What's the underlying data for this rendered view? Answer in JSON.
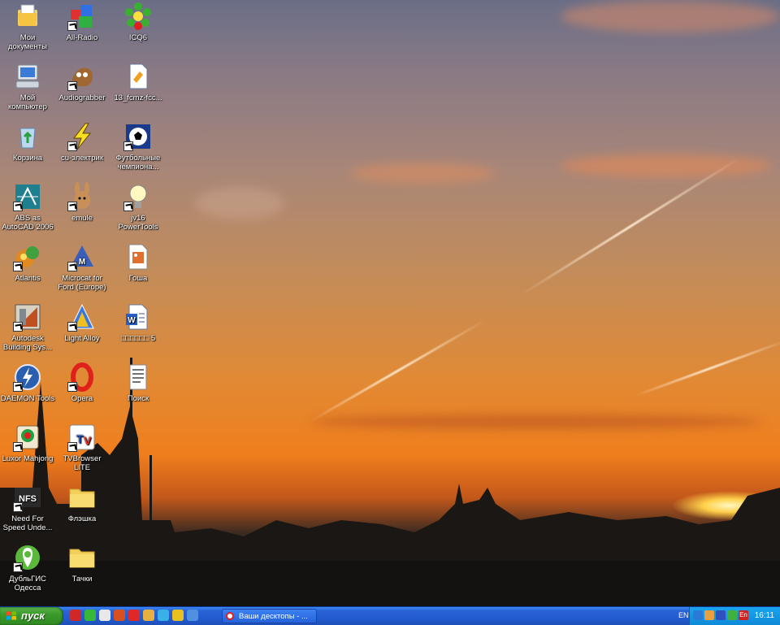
{
  "desktop": {
    "icons": [
      {
        "label": "Мои документы",
        "icon": "my-documents-icon",
        "shortcut": false
      },
      {
        "label": "Мой компьютер",
        "icon": "my-computer-icon",
        "shortcut": false
      },
      {
        "label": "Корзина",
        "icon": "recycle-bin-icon",
        "shortcut": false
      },
      {
        "label": "ABS as AutoCAD 2006",
        "icon": "autocad-icon",
        "shortcut": true
      },
      {
        "label": "Atlantis",
        "icon": "atlantis-icon",
        "shortcut": true
      },
      {
        "label": "Autodesk Building Sys...",
        "icon": "autodesk-building-icon",
        "shortcut": true
      },
      {
        "label": "DAEMON Tools",
        "icon": "daemon-tools-icon",
        "shortcut": true
      },
      {
        "label": "Luxor Mahjong",
        "icon": "luxor-mahjong-icon",
        "shortcut": true
      },
      {
        "label": "Need For Speed Unde...",
        "icon": "nfs-icon",
        "shortcut": true
      },
      {
        "label": "ДубльГИС Одесса",
        "icon": "dublgis-icon",
        "shortcut": true
      },
      {
        "label": "All-Radio",
        "icon": "all-radio-icon",
        "shortcut": true
      },
      {
        "label": "Audiograbber",
        "icon": "audiograbber-icon",
        "shortcut": true
      },
      {
        "label": "cu-электрик",
        "icon": "lightning-icon",
        "shortcut": true
      },
      {
        "label": "emule",
        "icon": "emule-icon",
        "shortcut": true
      },
      {
        "label": "Microcat for Ford (Europe)",
        "icon": "microcat-icon",
        "shortcut": true
      },
      {
        "label": "Light Alloy",
        "icon": "light-alloy-icon",
        "shortcut": true
      },
      {
        "label": "Opera",
        "icon": "opera-icon",
        "shortcut": true
      },
      {
        "label": "TVBrowser LITE",
        "icon": "tvbrowser-icon",
        "shortcut": true
      },
      {
        "label": "Флэшка",
        "icon": "folder-icon",
        "shortcut": false
      },
      {
        "label": "Тачки",
        "icon": "folder-icon",
        "shortcut": false
      },
      {
        "label": "ICQ6",
        "icon": "icq-icon",
        "shortcut": false
      },
      {
        "label": "13_fcmz-fcc...",
        "icon": "document-icon",
        "shortcut": false
      },
      {
        "label": "Футбольные чемпиона...",
        "icon": "football-icon",
        "shortcut": true
      },
      {
        "label": "jv16 PowerTools",
        "icon": "bulb-icon",
        "shortcut": true
      },
      {
        "label": "Гоша",
        "icon": "image-file-icon",
        "shortcut": false
      },
      {
        "label": "□□□□□□ 5",
        "icon": "word-document-icon",
        "shortcut": false
      },
      {
        "label": "Поиск",
        "icon": "text-file-icon",
        "shortcut": false
      }
    ]
  },
  "taskbar": {
    "start_label": "пуск",
    "quick_launch": [
      {
        "icon": "quicklaunch-1-icon",
        "color": "#d02828"
      },
      {
        "icon": "quicklaunch-2-icon",
        "color": "#38b838"
      },
      {
        "icon": "quicklaunch-3-icon",
        "color": "#e8e8e8"
      },
      {
        "icon": "quicklaunch-4-icon",
        "color": "#d85020"
      },
      {
        "icon": "quicklaunch-5-icon",
        "color": "#e02828"
      },
      {
        "icon": "quicklaunch-6-icon",
        "color": "#e8b040"
      },
      {
        "icon": "quicklaunch-7-icon",
        "color": "#3ab0e8"
      },
      {
        "icon": "quicklaunch-8-icon",
        "color": "#e8c020"
      },
      {
        "icon": "quicklaunch-9-icon",
        "color": "#5090e0"
      }
    ],
    "task_button": "Ваши десктопы - ...",
    "tray": {
      "language": "EN",
      "icons": [
        {
          "icon": "tray-arrow-icon",
          "color": "#2a7ad8"
        },
        {
          "icon": "tray-tools-icon",
          "color": "#e8a040"
        },
        {
          "icon": "tray-tv-icon",
          "color": "#3050c0"
        },
        {
          "icon": "tray-network-icon",
          "color": "#40b040"
        },
        {
          "icon": "tray-en-icon",
          "color": "#d02020"
        }
      ],
      "en_badge": "En",
      "clock": "16:11"
    }
  }
}
